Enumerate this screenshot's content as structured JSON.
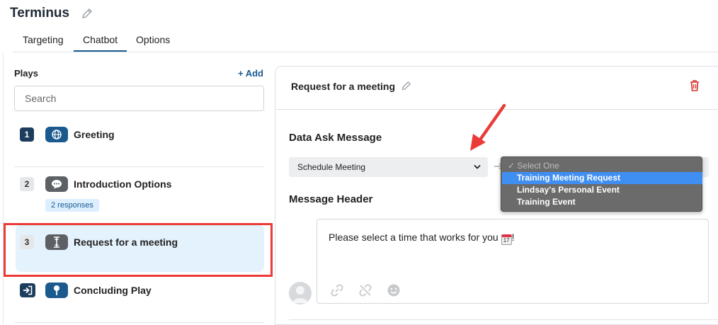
{
  "app": {
    "title": "Terminus"
  },
  "tabs": [
    {
      "label": "Targeting"
    },
    {
      "label": "Chatbot",
      "active": true
    },
    {
      "label": "Options"
    }
  ],
  "plays_panel": {
    "label": "Plays",
    "add_label": "+ Add",
    "search_placeholder": "Search",
    "items": [
      {
        "number": "1",
        "icon": "globe-icon",
        "name": "Greeting"
      },
      {
        "number": "2",
        "icon": "chat-bubble-icon",
        "name": "Introduction Options",
        "badge": "2 responses"
      },
      {
        "number": "3",
        "icon": "text-cursor-icon",
        "name": "Request for a meeting",
        "active": true
      },
      {
        "number": "",
        "icon": "exit-icon",
        "secondary_icon": "pin-icon",
        "name": "Concluding Play"
      }
    ]
  },
  "editor": {
    "title": "Request for a meeting",
    "data_ask_label": "Data Ask Message",
    "data_ask_value": "Schedule Meeting",
    "dropdown": {
      "placeholder": "✓ Select One",
      "options": [
        {
          "label": "Training Meeting Request",
          "selected": true
        },
        {
          "label": "Lindsay's Personal Event"
        },
        {
          "label": "Training Event"
        }
      ]
    },
    "message_header_label": "Message Header",
    "message_text": "Please select a time that works for you",
    "message_suffix": "!",
    "calendar_glyph": "17"
  },
  "colors": {
    "brand": "#1b5a8e",
    "highlight": "#ea3b39",
    "dropdown_selected": "#3f8ef2",
    "delete": "#d9302c"
  }
}
